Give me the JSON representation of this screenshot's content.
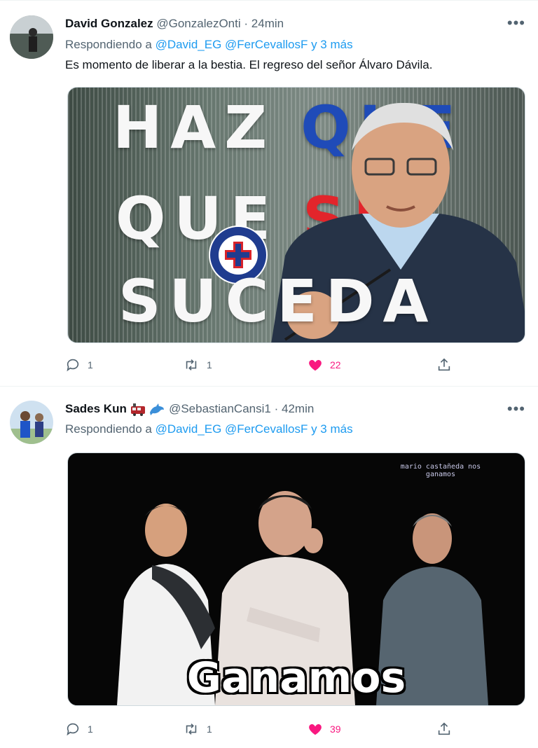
{
  "tweets": [
    {
      "name": "David Gonzalez",
      "handle": "@GonzalezOnti",
      "separator": "·",
      "time": "24min",
      "reply_prefix": "Respondiendo a",
      "reply_mentions": "@David_EG @FerCevallosF y 3 más",
      "text": "Es momento de liberar a la bestia. El regreso del señor Álvaro Dávila.",
      "media": {
        "line1": "HAZ",
        "line1b": "QUE",
        "line2": "QUE",
        "line2b": "SE",
        "line3": "SUCEDA"
      },
      "counts": {
        "replies": "1",
        "retweets": "1",
        "likes": "22"
      }
    },
    {
      "name": "Sades Kun",
      "handle": "@SebastianCansi1",
      "separator": "·",
      "time": "42min",
      "reply_prefix": "Respondiendo a",
      "reply_mentions": "@David_EG @FerCevallosF y 3 más",
      "media": {
        "caption": "Ganamos",
        "credit": "mario castañeda nos ganamos"
      },
      "counts": {
        "replies": "1",
        "retweets": "1",
        "likes": "39"
      }
    }
  ],
  "icons": {
    "more": "more-options-icon",
    "reply": "reply-icon",
    "retweet": "retweet-icon",
    "like": "heart-icon",
    "share": "share-icon"
  },
  "colors": {
    "link": "#1d9bf0",
    "like": "#f91880",
    "muted": "#536471"
  }
}
